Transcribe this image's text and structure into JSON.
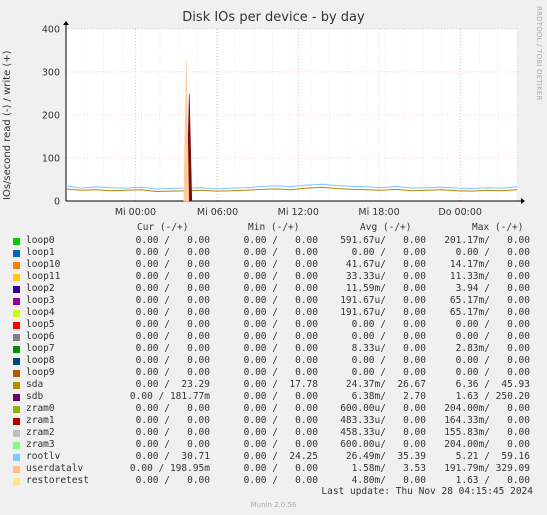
{
  "title": "Disk IOs per device - by day",
  "side_credit": "RRDTOOL / TOBI OETIKER",
  "footer": "Munin 2.0.56",
  "last_update": "Last update: Thu Nov 28 04:15:45 2024",
  "headers": [
    "Cur (-/+)",
    "Min (-/+)",
    "Avg (-/+)",
    "Max (-/+)"
  ],
  "colors": {
    "grid_red": "#ff9999",
    "bg": "#f0f0f0",
    "plot_bg": "#ffffff"
  },
  "chart_data": {
    "type": "line",
    "title": "Disk IOs per device - by day",
    "ylabel": "IOs/second read (-) / write (+)",
    "ylim": [
      0,
      400
    ],
    "yticks": [
      0,
      100,
      200,
      300,
      400
    ],
    "xticks": [
      "Mi 00:00",
      "Mi 06:00",
      "Mi 12:00",
      "Mi 18:00",
      "Do 00:00"
    ],
    "x": [
      0,
      1,
      2,
      3,
      4,
      5,
      6,
      7,
      8,
      9,
      10,
      11,
      12,
      13,
      14,
      15,
      16,
      17,
      18,
      19,
      20,
      21,
      22,
      23,
      24,
      25,
      26,
      27,
      28,
      29,
      30
    ],
    "series": [
      {
        "name": "sda",
        "color": "#b8860b",
        "values": [
          28,
          25,
          26,
          24,
          25,
          26,
          22,
          23,
          24,
          25,
          23,
          24,
          25,
          27,
          28,
          26,
          30,
          32,
          29,
          27,
          26,
          25,
          27,
          24,
          25,
          26,
          24,
          23,
          25,
          24,
          26
        ]
      },
      {
        "name": "rootlv",
        "color": "#7fc4ff",
        "values": [
          35,
          30,
          33,
          31,
          30,
          32,
          28,
          29,
          30,
          31,
          28,
          30,
          31,
          34,
          35,
          33,
          37,
          39,
          36,
          34,
          33,
          31,
          34,
          30,
          31,
          32,
          30,
          29,
          31,
          30,
          33
        ]
      },
      {
        "name": "sdb",
        "color": "#7a0a0a",
        "spike": {
          "at": 8.2,
          "value": 250
        }
      },
      {
        "name": "userdatalv",
        "color": "#ffcc99",
        "spike": {
          "at": 8.0,
          "value": 329
        }
      }
    ],
    "legend": [
      {
        "name": "loop0",
        "color": "#00cc00",
        "cur": "0.00 /   0.00",
        "min": "0.00 /   0.00",
        "avg": "591.67u/   0.00",
        "max": "201.17m/   0.00"
      },
      {
        "name": "loop1",
        "color": "#0066b3",
        "cur": "0.00 /   0.00",
        "min": "0.00 /   0.00",
        "avg": "0.00 /   0.00",
        "max": "0.00 /   0.00"
      },
      {
        "name": "loop10",
        "color": "#ff8000",
        "cur": "0.00 /   0.00",
        "min": "0.00 /   0.00",
        "avg": "41.67u/   0.00",
        "max": "14.17m/   0.00"
      },
      {
        "name": "loop11",
        "color": "#ffcc00",
        "cur": "0.00 /   0.00",
        "min": "0.00 /   0.00",
        "avg": "33.33u/   0.00",
        "max": "11.33m/   0.00"
      },
      {
        "name": "loop2",
        "color": "#330099",
        "cur": "0.00 /   0.00",
        "min": "0.00 /   0.00",
        "avg": "11.59m/   0.00",
        "max": "3.94 /   0.00"
      },
      {
        "name": "loop3",
        "color": "#990099",
        "cur": "0.00 /   0.00",
        "min": "0.00 /   0.00",
        "avg": "191.67u/   0.00",
        "max": "65.17m/   0.00"
      },
      {
        "name": "loop4",
        "color": "#ccff00",
        "cur": "0.00 /   0.00",
        "min": "0.00 /   0.00",
        "avg": "191.67u/   0.00",
        "max": "65.17m/   0.00"
      },
      {
        "name": "loop5",
        "color": "#ff0000",
        "cur": "0.00 /   0.00",
        "min": "0.00 /   0.00",
        "avg": "0.00 /   0.00",
        "max": "0.00 /   0.00"
      },
      {
        "name": "loop6",
        "color": "#808080",
        "cur": "0.00 /   0.00",
        "min": "0.00 /   0.00",
        "avg": "0.00 /   0.00",
        "max": "0.00 /   0.00"
      },
      {
        "name": "loop7",
        "color": "#008f00",
        "cur": "0.00 /   0.00",
        "min": "0.00 /   0.00",
        "avg": "8.33u/   0.00",
        "max": "2.83m/   0.00"
      },
      {
        "name": "loop8",
        "color": "#00487d",
        "cur": "0.00 /   0.00",
        "min": "0.00 /   0.00",
        "avg": "0.00 /   0.00",
        "max": "0.00 /   0.00"
      },
      {
        "name": "loop9",
        "color": "#b35a00",
        "cur": "0.00 /   0.00",
        "min": "0.00 /   0.00",
        "avg": "0.00 /   0.00",
        "max": "0.00 /   0.00"
      },
      {
        "name": "sda",
        "color": "#b38f00",
        "cur": "0.00 /  23.29",
        "min": "0.00 /  17.78",
        "avg": "24.37m/  26.67",
        "max": "6.36 /  45.93"
      },
      {
        "name": "sdb",
        "color": "#6b006b",
        "cur": "0.00 / 181.77m",
        "min": "0.00 /   0.00",
        "avg": "6.38m/   2.70",
        "max": "1.63 / 250.20"
      },
      {
        "name": "zram0",
        "color": "#8fb300",
        "cur": "0.00 /   0.00",
        "min": "0.00 /   0.00",
        "avg": "600.00u/   0.00",
        "max": "204.00m/   0.00"
      },
      {
        "name": "zram1",
        "color": "#b30000",
        "cur": "0.00 /   0.00",
        "min": "0.00 /   0.00",
        "avg": "483.33u/   0.00",
        "max": "164.33m/   0.00"
      },
      {
        "name": "zram2",
        "color": "#bebebe",
        "cur": "0.00 /   0.00",
        "min": "0.00 /   0.00",
        "avg": "458.33u/   0.00",
        "max": "155.83m/   0.00"
      },
      {
        "name": "zram3",
        "color": "#80ff80",
        "cur": "0.00 /   0.00",
        "min": "0.00 /   0.00",
        "avg": "600.00u/   0.00",
        "max": "204.00m/   0.00"
      },
      {
        "name": "rootlv",
        "color": "#80c9ff",
        "cur": "0.00 /  30.71",
        "min": "0.00 /  24.25",
        "avg": "26.49m/  35.39",
        "max": "5.21 /  59.16"
      },
      {
        "name": "userdatalv",
        "color": "#ffc080",
        "cur": "0.00 / 198.95m",
        "min": "0.00 /   0.00",
        "avg": "1.58m/   3.53",
        "max": "191.79m/ 329.09"
      },
      {
        "name": "restoretest",
        "color": "#ffe680",
        "cur": "0.00 /   0.00",
        "min": "0.00 /   0.00",
        "avg": "4.80m/   0.00",
        "max": "1.63 /   0.00"
      }
    ]
  }
}
